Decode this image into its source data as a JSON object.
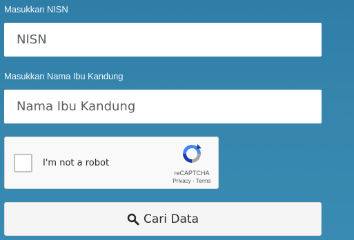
{
  "form": {
    "nisn_label": "Masukkan NISN",
    "nisn_placeholder": "NISN",
    "mother_label": "Masukkan Nama Ibu Kandung",
    "mother_placeholder": "Nama Ibu Kandung"
  },
  "captcha": {
    "checkbox_text": "I'm not a robot",
    "brand": "reCAPTCHA",
    "links": "Privacy - Terms",
    "icon": "recaptcha-logo-icon"
  },
  "submit": {
    "label": "Cari Data",
    "icon": "search-icon"
  },
  "colors": {
    "background": "#3585ad",
    "field": "#ffffff",
    "button": "#f5f5f5"
  }
}
